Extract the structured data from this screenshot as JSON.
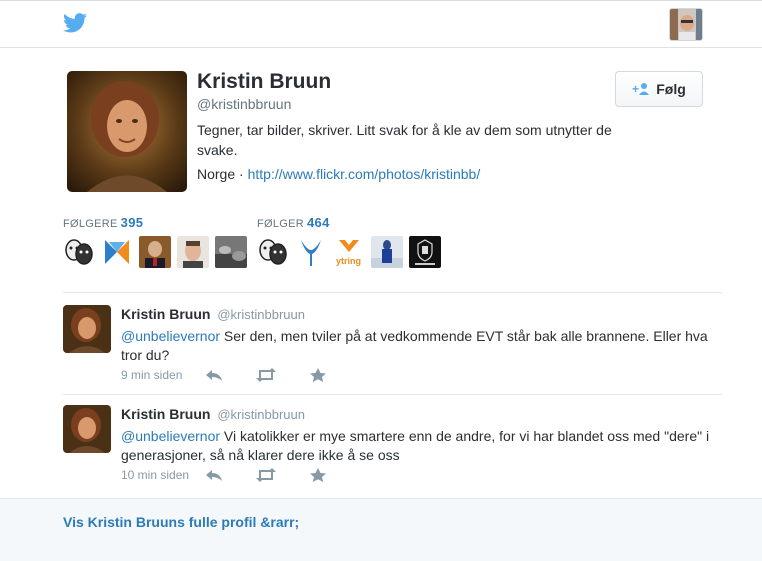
{
  "header": {
    "logo_icon": "twitter-bird-icon",
    "brand_color": "#55acee"
  },
  "profile": {
    "name": "Kristin Bruun",
    "handle": "@kristinbbruun",
    "bio": "Tegner, tar bilder, skriver. Litt svak for å kle av dem som utnytter de svake.",
    "location": "Norge",
    "separator": "·",
    "url": "http://www.flickr.com/photos/kristinbb/",
    "follow_label": "Følg"
  },
  "stats": {
    "followers_label": "FØLGERE",
    "followers_count": "395",
    "following_label": "FØLGER",
    "following_count": "464"
  },
  "tweets": [
    {
      "name": "Kristin Bruun",
      "handle": "@kristinbbruun",
      "mention": "@unbelievernor",
      "text": " Ser den, men tviler på at vedkommende EVT står bak alle brannene. Eller  hva tror du?",
      "time": "9 min siden"
    },
    {
      "name": "Kristin Bruun",
      "handle": "@kristinbbruun",
      "mention": "@unbelievernor",
      "text": " Vi katolikker er mye smartere enn de andre, for vi har blandet oss med \"dere\" i generasjoner, så nå klarer dere ikke å se oss",
      "time": "10 min siden"
    }
  ],
  "footer": {
    "link_label": "Vis Kristin Bruuns fulle profil &rarr;"
  },
  "colors": {
    "link": "#2b7bb9",
    "text": "#292f33",
    "muted": "#8899a6"
  }
}
